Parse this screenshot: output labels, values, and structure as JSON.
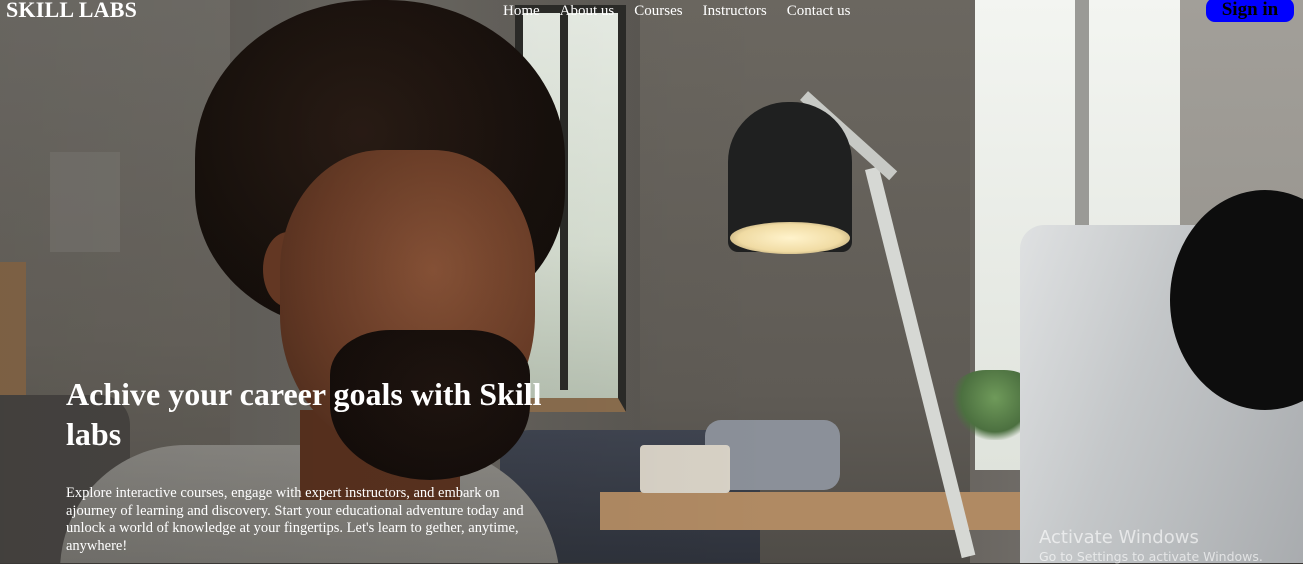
{
  "site": {
    "brand": "SKILL LABS"
  },
  "nav": {
    "items": [
      {
        "label": "Home"
      },
      {
        "label": "About us"
      },
      {
        "label": "Courses"
      },
      {
        "label": "Instructors"
      },
      {
        "label": "Contact us"
      }
    ],
    "signin_label": "Sign in"
  },
  "hero": {
    "title": "Achive your career goals with Skill labs",
    "description": "Explore interactive courses, engage with expert instructors, and embark on ajourney of learning and discovery. Start your educational adventure today and unlock a world of knowledge at your fingertips. Let's learn to gether, anytime, anywhere!"
  },
  "watermark": {
    "title": "Activate Windows",
    "subtitle": "Go to Settings to activate Windows."
  },
  "colors": {
    "signin_bg": "#0000ff",
    "text": "#ffffff"
  }
}
